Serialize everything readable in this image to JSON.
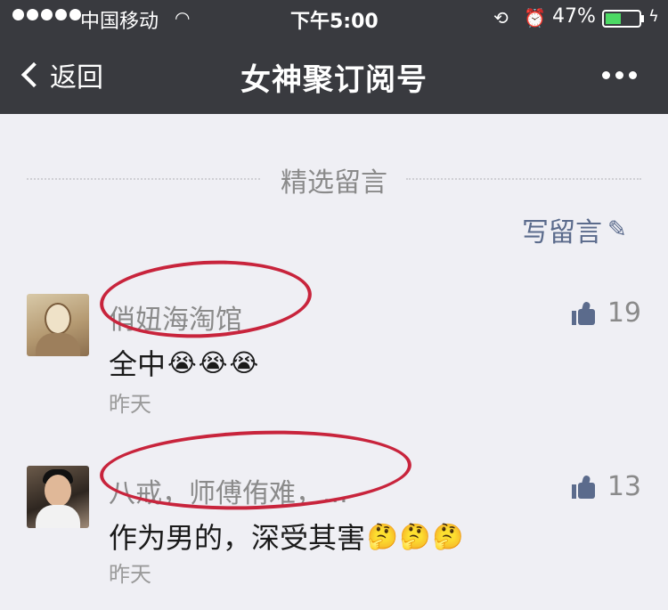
{
  "status_bar": {
    "carrier": "中国移动",
    "time": "下午5:00",
    "battery_percent": "47%",
    "battery_level": 0.47,
    "icons": [
      "signal-dots",
      "wifi-icon",
      "orientation-lock-icon",
      "alarm-icon",
      "battery-icon",
      "charging-icon"
    ]
  },
  "nav": {
    "back_label": "返回",
    "title": "女神聚订阅号",
    "more_icon": "more-dots-icon"
  },
  "section": {
    "title": "精选留言",
    "write_comment_label": "写留言",
    "write_icon": "pencil-icon"
  },
  "comments": [
    {
      "nickname": "俏妞海淘馆",
      "text": "全中",
      "emojis": [
        "😭",
        "😭",
        "😭"
      ],
      "time": "昨天",
      "likes": "19"
    },
    {
      "nickname": "八戒，师傅侑难，...",
      "text": "作为男的，深受其害",
      "emojis": [
        "🤔",
        "🤔",
        "🤔"
      ],
      "time": "昨天",
      "likes": "13"
    }
  ],
  "colors": {
    "nav_background": "#393a3f",
    "page_background": "#efeff4",
    "link_blue": "#5b6b8c",
    "annotation_red": "#c8243c"
  }
}
